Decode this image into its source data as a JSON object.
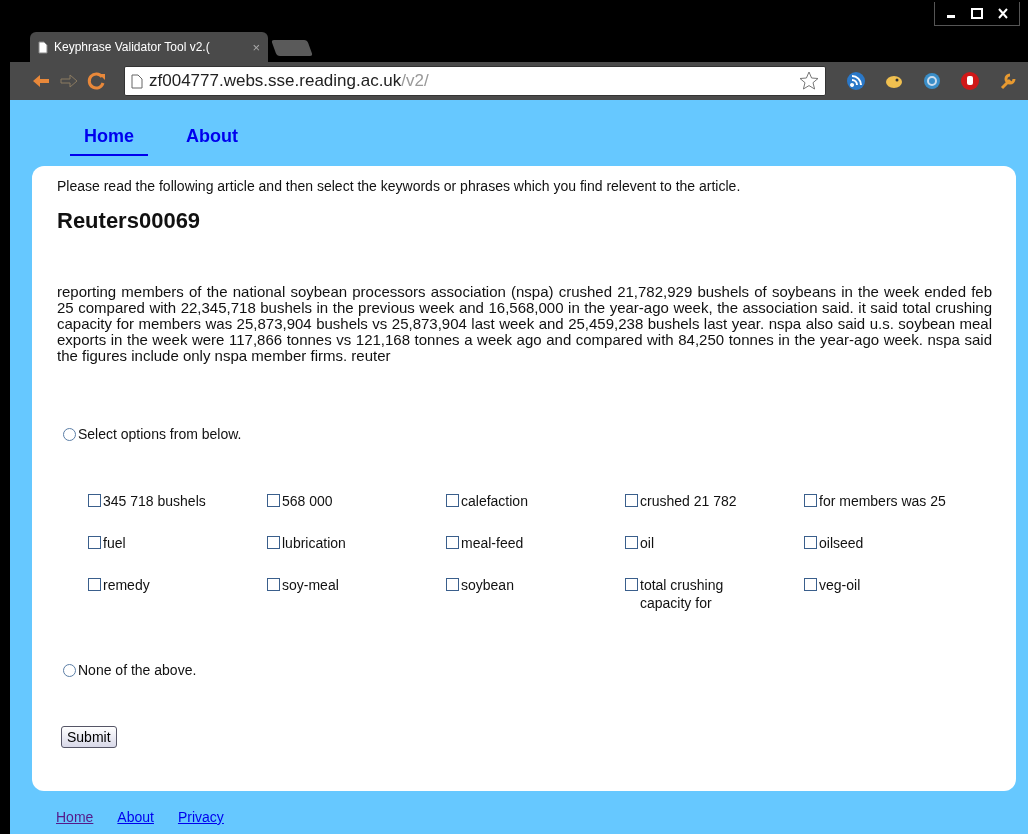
{
  "browser": {
    "tabs": [
      {
        "title": "Keyphrase Validator Tool v2.(",
        "selected": true,
        "close": "×"
      }
    ],
    "address": {
      "host": "zf004777.webs.sse.reading.ac.uk",
      "path": "/v2/"
    }
  },
  "nav": [
    {
      "label": "Home",
      "selected": true
    },
    {
      "label": "About",
      "selected": false
    }
  ],
  "intro": "Please read the following article and then select the keywords or phrases which you find relevent to the article.",
  "article": {
    "title": "Reuters00069",
    "body": "reporting members of the national soybean processors association (nspa) crushed 21,782,929 bushels of soybeans in the week ended feb 25 compared with 22,345,718 bushels in the previous week and 16,568,000 in the year-ago week, the association said. it said total crushing capacity for members was 25,873,904 bushels vs 25,873,904 last week and 25,459,238 bushels last year. nspa also said u.s. soybean meal exports in the week were 117,866 tonnes vs 121,168 tonnes a week ago and compared with 84,250 tonnes in the year-ago week. nspa said the figures include only nspa member firms. reuter"
  },
  "choices": [
    {
      "label": "Select options from below.",
      "selected": false
    },
    {
      "label": "None of the above.",
      "selected": false
    }
  ],
  "options": [
    {
      "label": "345 718 bushels",
      "checked": false
    },
    {
      "label": "568 000",
      "checked": false
    },
    {
      "label": "calefaction",
      "checked": false
    },
    {
      "label": "crushed 21 782",
      "checked": false
    },
    {
      "label": "for members was 25",
      "checked": false
    },
    {
      "label": "fuel",
      "checked": false
    },
    {
      "label": "lubrication",
      "checked": false
    },
    {
      "label": "meal-feed",
      "checked": false
    },
    {
      "label": "oil",
      "checked": false
    },
    {
      "label": "oilseed",
      "checked": false
    },
    {
      "label": "remedy",
      "checked": false
    },
    {
      "label": "soy-meal",
      "checked": false
    },
    {
      "label": "soybean",
      "checked": false
    },
    {
      "label": "total crushing capacity for",
      "checked": false
    },
    {
      "label": "veg-oil",
      "checked": false
    }
  ],
  "submit": "Submit",
  "footer": [
    {
      "label": "Home",
      "visited": true
    },
    {
      "label": "About",
      "visited": false
    },
    {
      "label": "Privacy",
      "visited": false
    }
  ]
}
